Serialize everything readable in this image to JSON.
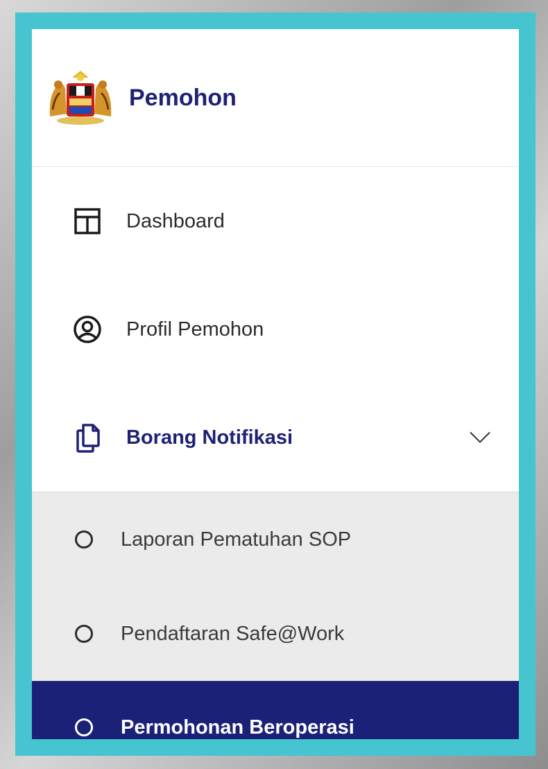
{
  "header": {
    "brand": "Pemohon",
    "logo_icon": "malaysia-coat-of-arms"
  },
  "menu": [
    {
      "label": "Dashboard",
      "icon": "layout-icon"
    },
    {
      "label": "Profil Pemohon",
      "icon": "user-circle-icon"
    },
    {
      "label": "Borang Notifikasi",
      "icon": "copy-icon",
      "expanded": true,
      "submenu": [
        {
          "label": "Laporan Pematuhan SOP",
          "active": false
        },
        {
          "label": "Pendaftaran Safe@Work",
          "active": false
        },
        {
          "label": "Permohonan Beroperasi",
          "active": true
        }
      ]
    }
  ],
  "colors": {
    "frame": "#46c4d0",
    "brand": "#1e2175",
    "active_bg": "#1c2178",
    "submenu_bg": "#ebebeb"
  }
}
